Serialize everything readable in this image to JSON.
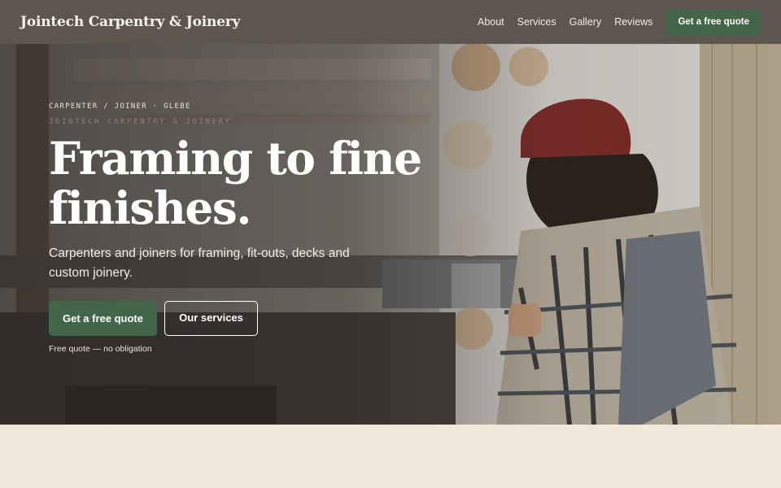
{
  "header": {
    "brand": "Jointech Carpentry & Joinery",
    "nav": [
      "About",
      "Services",
      "Gallery",
      "Reviews"
    ],
    "cta": "Get a free quote"
  },
  "hero": {
    "eyebrow": "CARPENTER / JOINER · GLEBE",
    "sub_eyebrow": "JOINTECH CARPENTRY & JOINERY",
    "headline_line1": "Framing to fine",
    "headline_line2": "finishes.",
    "tagline": "Carpenters and joiners for framing, fit-outs, decks and custom joinery.",
    "primary_button": "Get a free quote",
    "secondary_button": "Our services",
    "note": "Free quote — no obligation",
    "image_icon": "carpenter-workshop-photo"
  },
  "colors": {
    "header_bg": "#5d5650",
    "accent_green": "#43654a",
    "page_bg": "#f2e8da"
  }
}
